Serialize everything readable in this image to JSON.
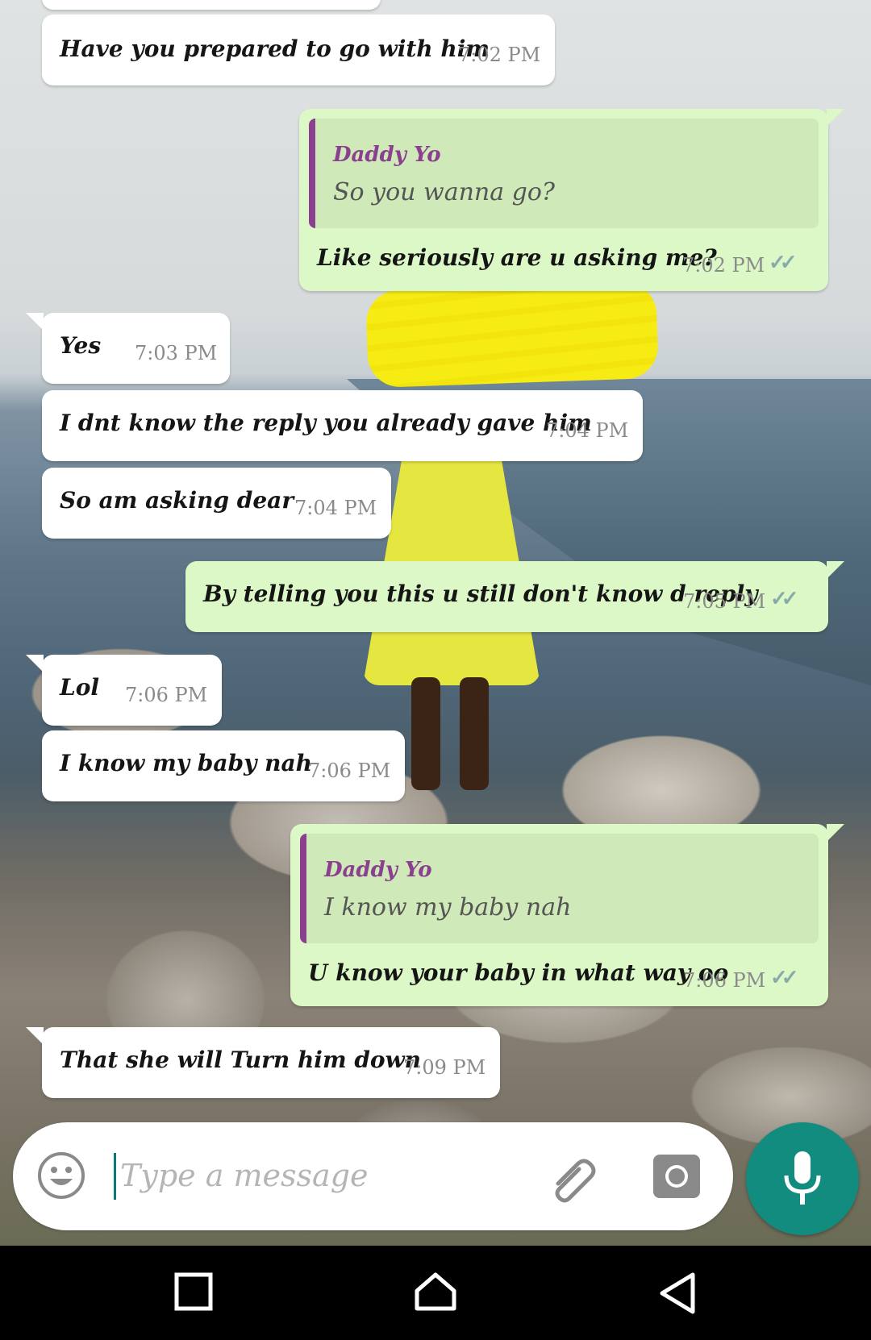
{
  "messages": [
    {
      "text": "Have you prepared to go with him",
      "time": "7:02 PM"
    },
    {
      "quote_author": "Daddy Yo",
      "quote_text": "So you wanna go?",
      "text": "Like seriously are u asking me?",
      "time": "7:02 PM"
    },
    {
      "text": "Yes",
      "time": "7:03 PM"
    },
    {
      "text": "I dnt know the reply you already gave him",
      "time": "7:04 PM"
    },
    {
      "text": "So am asking dear",
      "time": "7:04 PM"
    },
    {
      "text": "By telling you this u still don't know d reply",
      "time": "7:05 PM"
    },
    {
      "text": "Lol",
      "time": "7:06 PM"
    },
    {
      "text": "I know my baby nah",
      "time": "7:06 PM"
    },
    {
      "quote_author": "Daddy Yo",
      "quote_text": "I know my baby nah",
      "text": "U know your baby in what way oo",
      "time": "7:06 PM"
    },
    {
      "text": "That she will Turn him down",
      "time": "7:09 PM"
    }
  ],
  "composer": {
    "placeholder": "Type a message"
  },
  "icons": {
    "emoji": "emoji-icon",
    "attach": "paperclip-icon",
    "camera": "camera-icon",
    "mic": "microphone-icon",
    "nav": [
      "recents-square-icon",
      "home-icon",
      "back-triangle-icon"
    ]
  },
  "colors": {
    "incoming": "#ffffff",
    "outgoing": "#dcf8c6",
    "quote_accent": "#8a3f8f",
    "accent": "#128c7e"
  }
}
